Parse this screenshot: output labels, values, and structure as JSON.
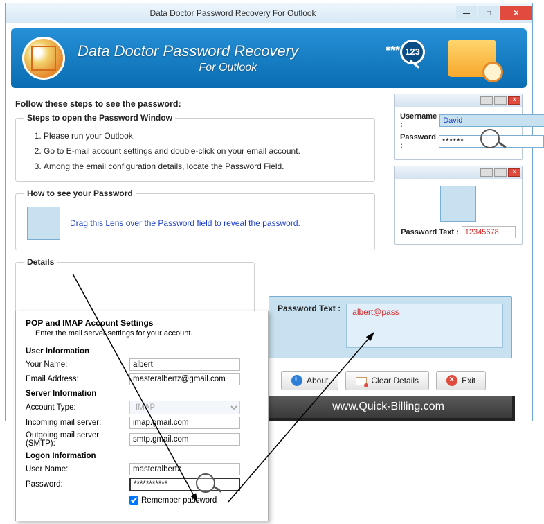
{
  "window": {
    "title": "Data Doctor Password Recovery For Outlook"
  },
  "banner": {
    "title_line1": "Data Doctor Password Recovery",
    "title_line2": "For Outlook",
    "stars": "***",
    "badge": "123"
  },
  "instructions": {
    "header": "Follow these steps to see the password:",
    "steps_legend": "Steps to open the Password Window",
    "steps": [
      "Please run your Outlook.",
      "Go to E-mail account settings and double-click on your email account.",
      "Among the email configuration details, locate the Password Field."
    ],
    "howto_legend": "How to see your Password",
    "howto_text": "Drag this Lens over the Password field to reveal the password.",
    "details_legend": "Details"
  },
  "mini_login": {
    "username_label": "Username :",
    "username_value": "David",
    "password_label": "Password  :",
    "password_value": "******"
  },
  "mini_result": {
    "label": "Password Text :",
    "value": "12345678"
  },
  "password_panel": {
    "label": "Password Text :",
    "value": "albert@pass"
  },
  "buttons": {
    "about": "About",
    "clear": "Clear Details",
    "exit": "Exit"
  },
  "footer_url": "www.Quick-Billing.com",
  "dialog": {
    "title": "POP and IMAP Account Settings",
    "subtitle": "Enter the mail server settings for your account.",
    "user_info_header": "User Information",
    "your_name_label": "Your Name:",
    "your_name_value": "albert",
    "email_label": "Email Address:",
    "email_value": "masteralbertz@gmail.com",
    "server_info_header": "Server Information",
    "account_type_label": "Account Type:",
    "account_type_value": "IMAP",
    "incoming_label": "Incoming mail server:",
    "incoming_value": "imap.gmail.com",
    "outgoing_label": "Outgoing mail server (SMTP):",
    "outgoing_value": "smtp.gmail.com",
    "logon_info_header": "Logon Information",
    "user_name_label": "User Name:",
    "user_name_value": "masteralbertz",
    "password_label": "Password:",
    "password_value": "***********",
    "remember_label": "Remember password"
  }
}
